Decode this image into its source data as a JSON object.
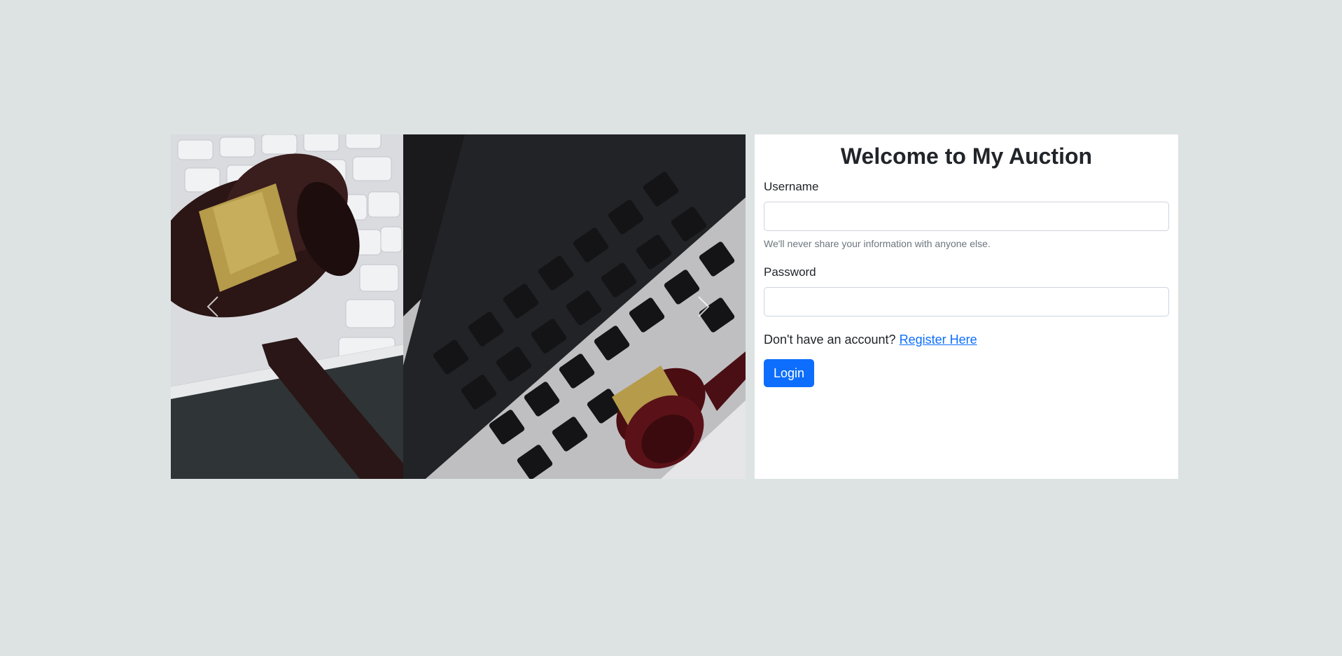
{
  "carousel": {
    "prev_icon": "chevron-left-icon",
    "next_icon": "chevron-right-icon",
    "slides": [
      "gavel-on-keyboard-photo",
      "gavel-on-laptop-photo"
    ]
  },
  "login": {
    "title": "Welcome to My Auction",
    "username_label": "Username",
    "username_value": "",
    "username_help": "We'll never share your information with anyone else.",
    "password_label": "Password",
    "password_value": "",
    "register_prompt": "Don't have an account?",
    "register_link": "Register Here",
    "login_button": "Login"
  },
  "colors": {
    "background": "#dde3e3",
    "panel": "#ffffff",
    "primary": "#0d6efd",
    "muted_text": "#6c757d"
  }
}
